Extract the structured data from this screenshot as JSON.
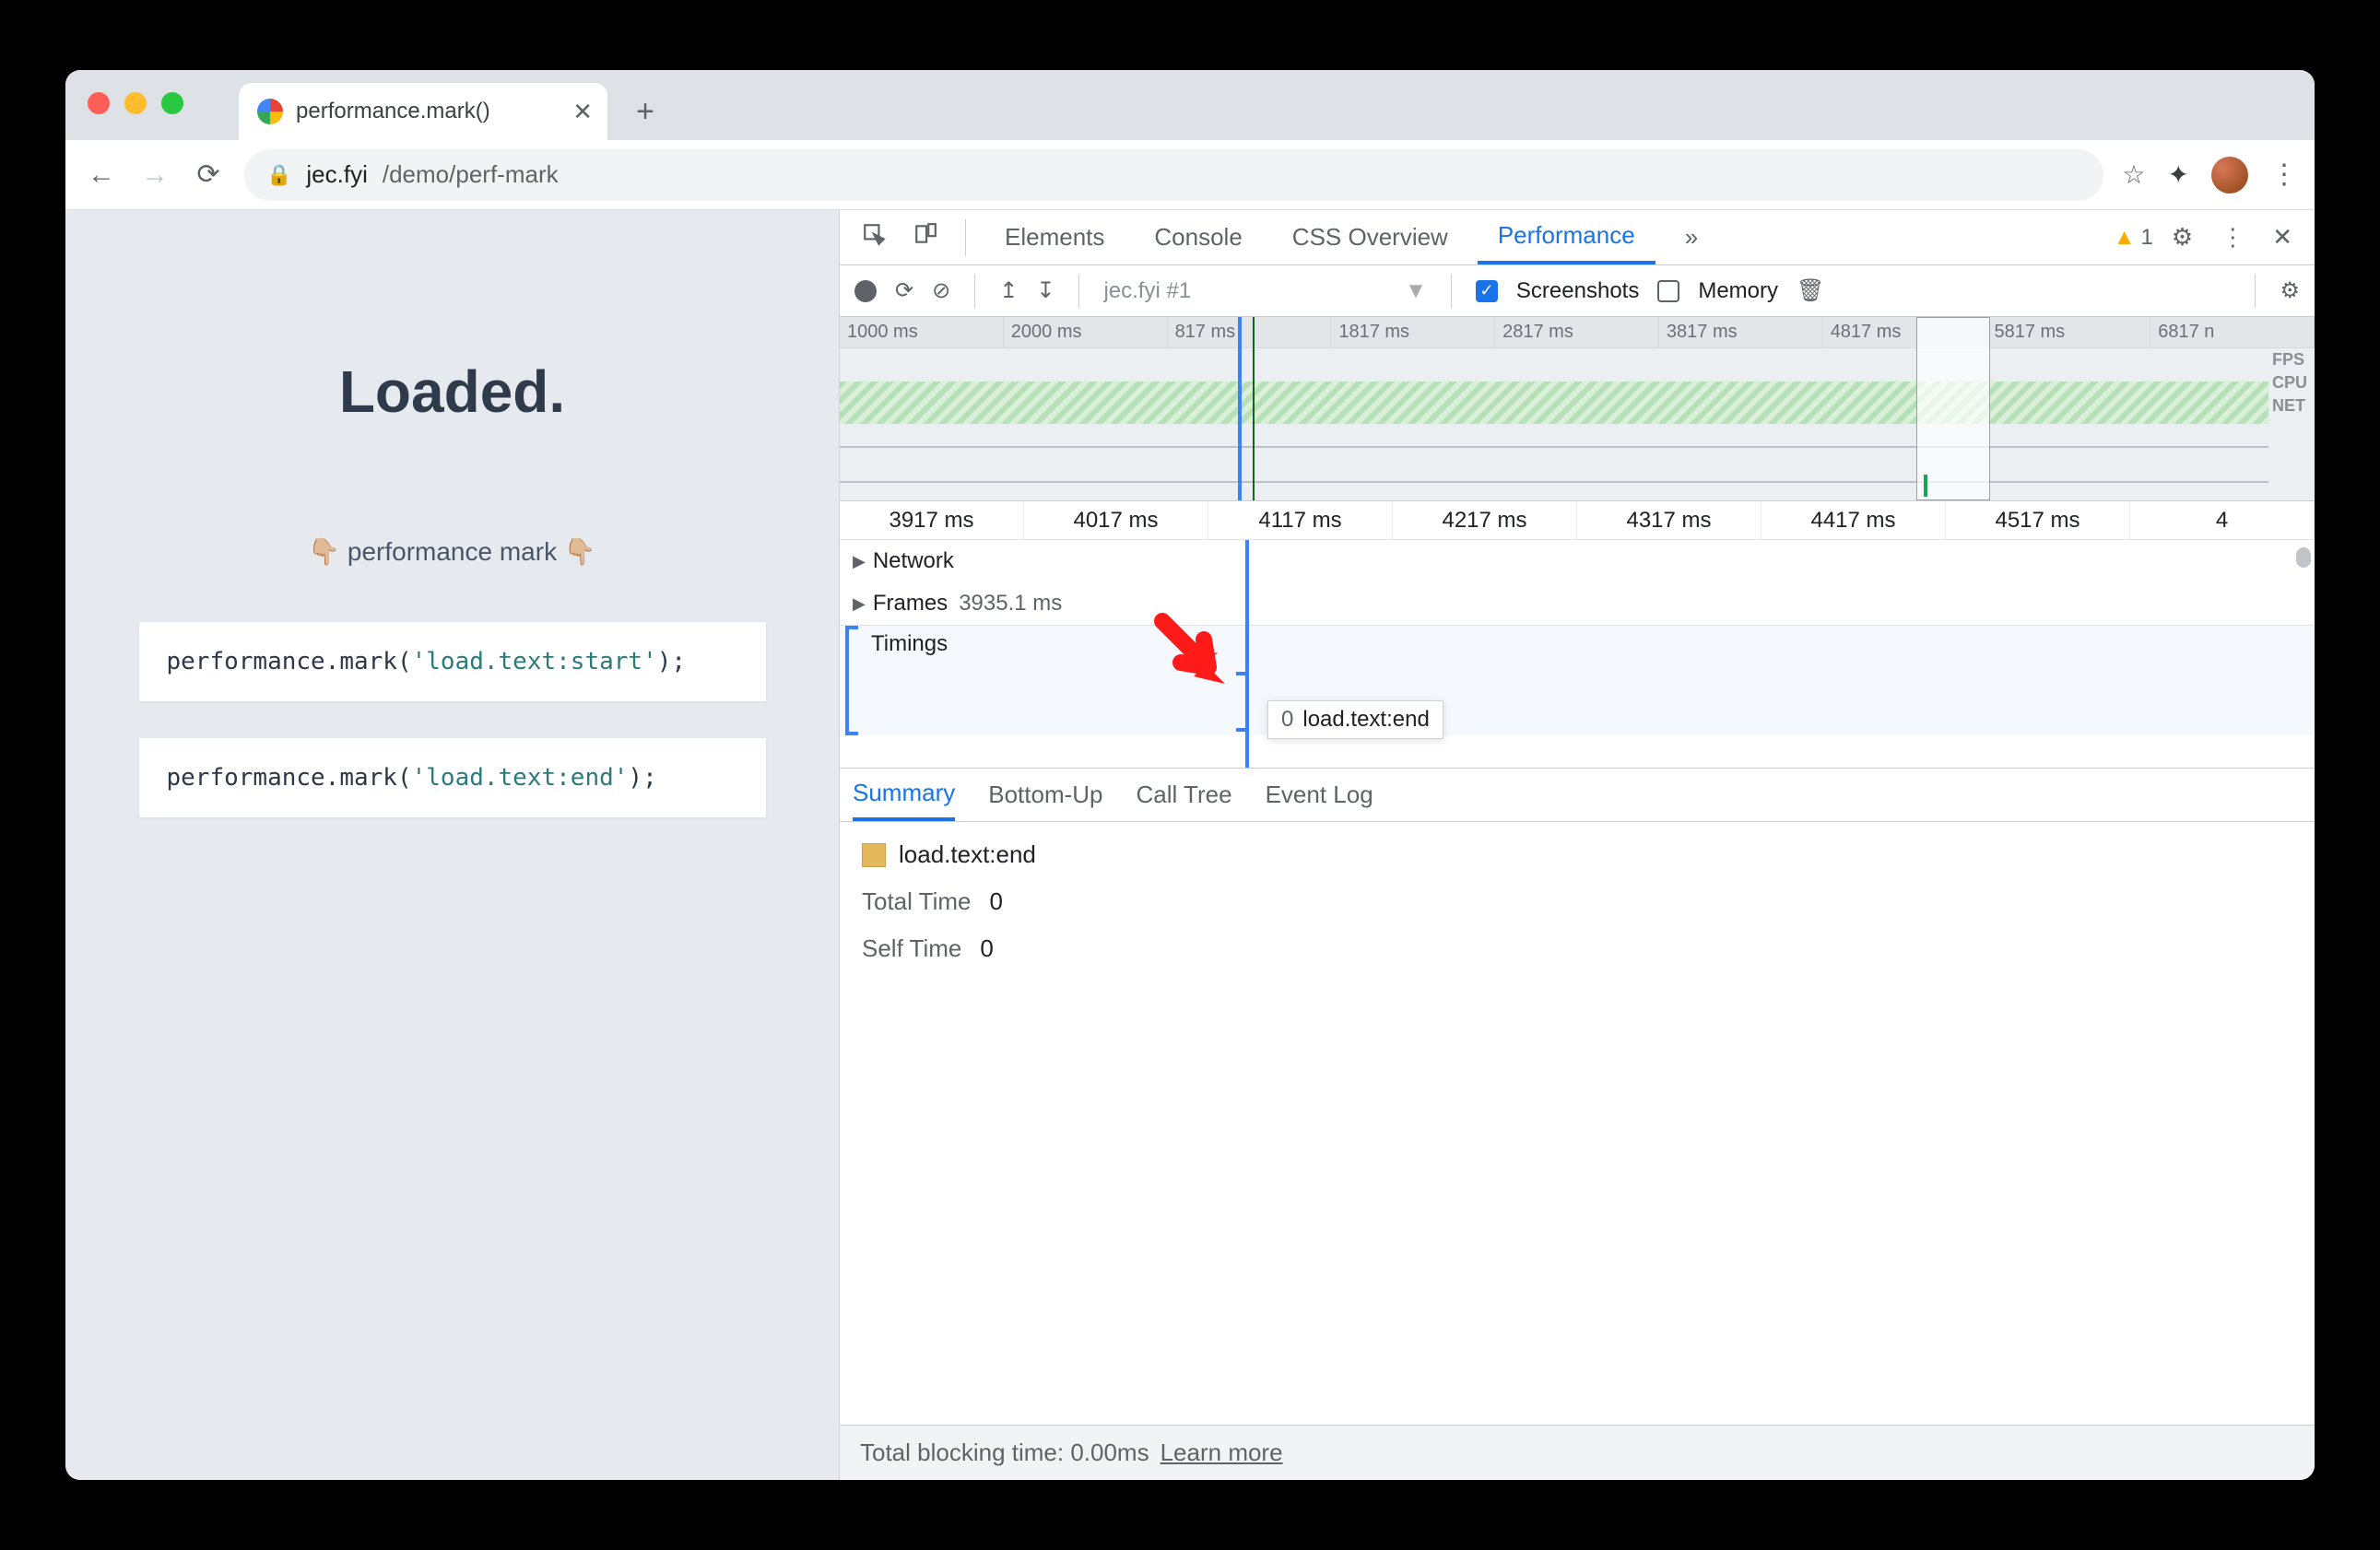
{
  "tab": {
    "title": "performance.mark()"
  },
  "url": {
    "host": "jec.fyi",
    "path": "/demo/perf-mark"
  },
  "page": {
    "heading": "Loaded.",
    "subheading": "👇🏼 performance mark 👇🏼",
    "code1_pre": "performance.mark(",
    "code1_str": "'load.text:start'",
    "code1_post": ");",
    "code2_pre": "performance.mark(",
    "code2_str": "'load.text:end'",
    "code2_post": ");"
  },
  "devtools": {
    "tabs": {
      "elements": "Elements",
      "console": "Console",
      "css_overview": "CSS Overview",
      "performance": "Performance",
      "more": "»"
    },
    "warning_count": "1",
    "perf_toolbar": {
      "recording_label": "jec.fyi #1",
      "screenshots": "Screenshots",
      "memory": "Memory"
    },
    "overview_ticks": [
      "1000 ms",
      "2000 ms",
      "817 ms",
      "1817 ms",
      "2817 ms",
      "3817 ms",
      "4817 ms",
      "5817 ms",
      "6817 n"
    ],
    "overview_labels": {
      "fps": "FPS",
      "cpu": "CPU",
      "net": "NET"
    },
    "flame_ticks": [
      "3917 ms",
      "4017 ms",
      "4117 ms",
      "4217 ms",
      "4317 ms",
      "4417 ms",
      "4517 ms",
      "4"
    ],
    "tracks": {
      "network": "Network",
      "frames": "Frames",
      "frames_ms": "3935.1 ms",
      "timings": "Timings"
    },
    "tooltip": {
      "duration": "0",
      "name": "load.text:end"
    },
    "detail_tabs": {
      "summary": "Summary",
      "bottomup": "Bottom-Up",
      "calltree": "Call Tree",
      "eventlog": "Event Log"
    },
    "summary": {
      "event_name": "load.text:end",
      "total_time_label": "Total Time",
      "total_time_value": "0",
      "self_time_label": "Self Time",
      "self_time_value": "0"
    },
    "footer": {
      "blocking": "Total blocking time: 0.00ms",
      "learn_more": "Learn more"
    }
  }
}
